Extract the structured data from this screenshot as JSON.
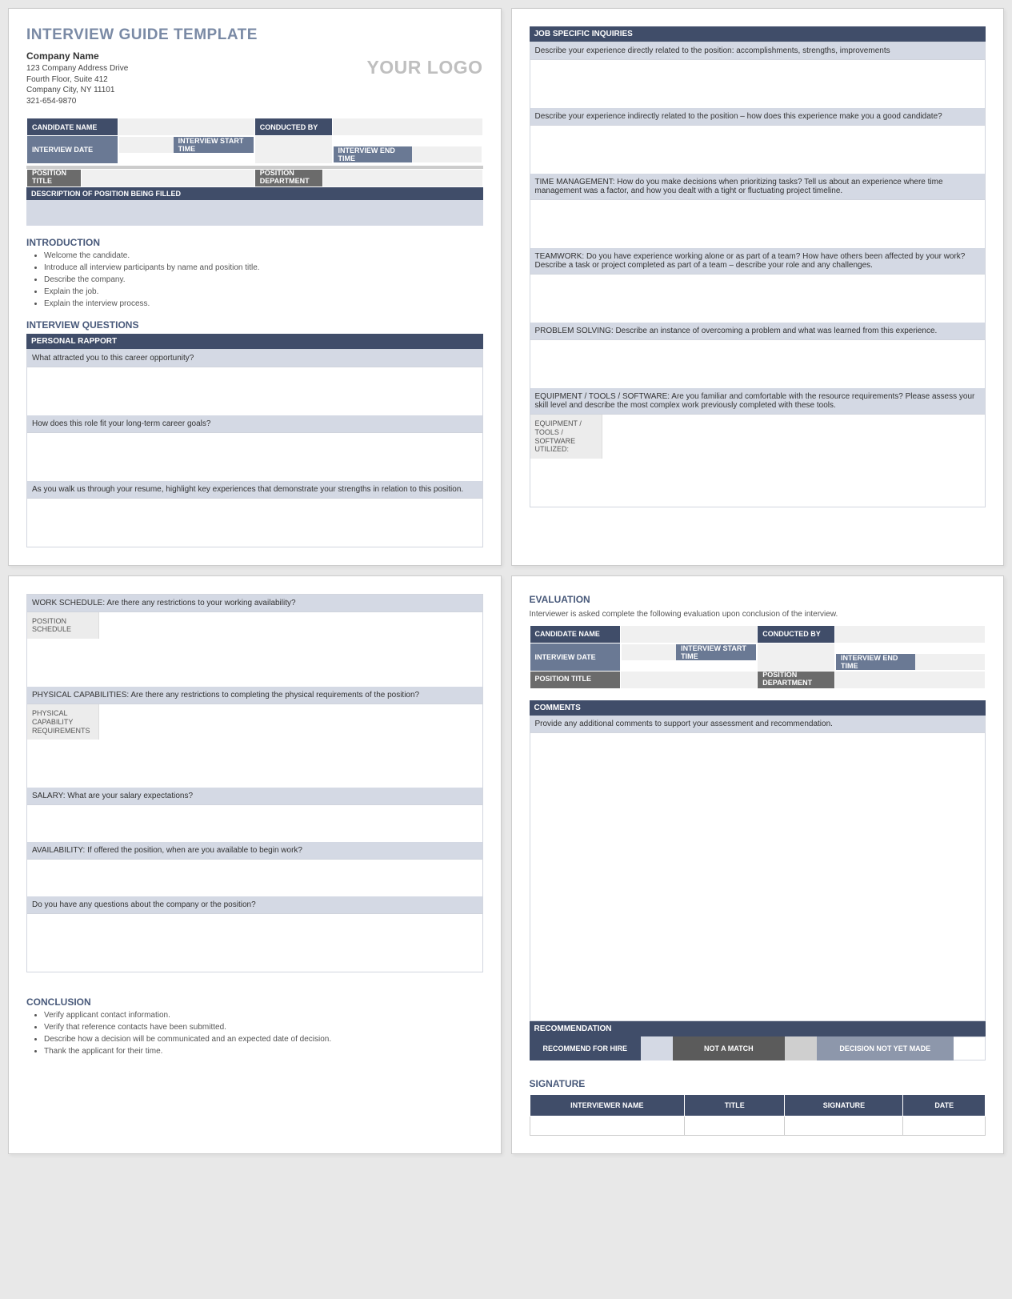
{
  "title": "INTERVIEW GUIDE TEMPLATE",
  "logo_text": "YOUR LOGO",
  "company": {
    "name": "Company Name",
    "addr1": "123 Company Address Drive",
    "addr2": "Fourth Floor, Suite 412",
    "city": "Company City, NY  11101",
    "phone": "321-654-9870"
  },
  "fields": {
    "candidate_name": "CANDIDATE NAME",
    "conducted_by": "CONDUCTED BY",
    "interview_date": "INTERVIEW DATE",
    "start_time": "INTERVIEW START TIME",
    "end_time": "INTERVIEW END TIME",
    "position_title": "POSITION TITLE",
    "position_dept": "POSITION DEPARTMENT",
    "desc_head": "DESCRIPTION OF POSITION BEING FILLED"
  },
  "intro_head": "INTRODUCTION",
  "intro_items": [
    "Welcome the candidate.",
    "Introduce all interview participants by name and position title.",
    "Describe the company.",
    "Explain the job.",
    "Explain the interview process."
  ],
  "iq_head": "INTERVIEW QUESTIONS",
  "rapport_head": "PERSONAL RAPPORT",
  "rapport_q": [
    "What attracted you to this career opportunity?",
    "How does this role fit your long-term career goals?",
    "As you walk us through your resume, highlight key experiences that demonstrate your strengths in relation to this position."
  ],
  "job_head": "JOB SPECIFIC INQUIRIES",
  "job_q": [
    "Describe your experience directly related to the position: accomplishments, strengths, improvements",
    "Describe your experience indirectly related to the position – how does this experience make you a good candidate?",
    "TIME MANAGEMENT: How do you make decisions when prioritizing tasks? Tell us about an experience where time management was a factor, and how you dealt with a tight or fluctuating project timeline.",
    "TEAMWORK: Do you have experience working alone or as part of a team? How have others been affected by your work? Describe a task or project completed as part of a team – describe your role and any challenges.",
    "PROBLEM SOLVING: Describe an instance of overcoming a problem and what was learned from this experience.",
    "EQUIPMENT / TOOLS / SOFTWARE: Are you familiar and comfortable with the resource requirements? Please assess your skill level and describe the most complex work previously completed with these tools."
  ],
  "equip_label": "EQUIPMENT / TOOLS / SOFTWARE UTILIZED:",
  "page3_q": [
    "WORK SCHEDULE: Are there any restrictions to your working availability?",
    "PHYSICAL CAPABILITIES: Are there any restrictions to completing the physical requirements of the position?",
    "SALARY: What are your salary expectations?",
    "AVAILABILITY:  If offered the position, when are you available to begin work?",
    "Do you have any questions about the company or the position?"
  ],
  "pos_sched_label": "POSITION SCHEDULE",
  "phys_cap_label": "PHYSICAL CAPABILITY REQUIREMENTS",
  "conclusion_head": "CONCLUSION",
  "conclusion_items": [
    "Verify applicant contact information.",
    "Verify that reference contacts have been submitted.",
    "Describe how a decision will be communicated and an expected date of decision.",
    "Thank the applicant for their time."
  ],
  "eval_head": "EVALUATION",
  "eval_intro": "Interviewer is asked complete the following evaluation upon conclusion of the interview.",
  "comments_head": "COMMENTS",
  "comments_prompt": "Provide any additional comments to support your assessment and recommendation.",
  "rec_head": "RECOMMENDATION",
  "rec_opts": [
    "RECOMMEND FOR HIRE",
    "NOT A MATCH",
    "DECISION NOT YET MADE"
  ],
  "sig_head": "SIGNATURE",
  "sig_cols": [
    "INTERVIEWER NAME",
    "TITLE",
    "SIGNATURE",
    "DATE"
  ]
}
